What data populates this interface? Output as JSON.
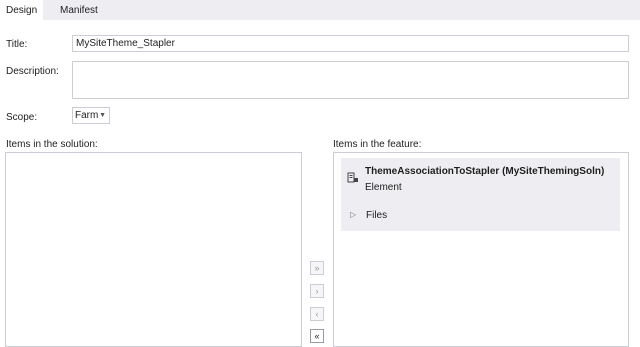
{
  "tabs": [
    {
      "label": "Design"
    },
    {
      "label": "Manifest"
    }
  ],
  "form": {
    "title_label": "Title:",
    "title_value": "MySiteTheme_Stapler",
    "description_label": "Description:",
    "description_value": "",
    "scope_label": "Scope:",
    "scope_value": "Farm"
  },
  "solution": {
    "label": "Items in the solution:"
  },
  "feature": {
    "label": "Items in the feature:",
    "item_title": "ThemeAssociationToStapler (MySiteThemingSoln)",
    "item_type": "Element",
    "item_icon": "element-icon",
    "files_label": "Files"
  },
  "move_buttons": {
    "add_all": "»",
    "add": "›",
    "remove": "‹",
    "remove_all": "«"
  }
}
